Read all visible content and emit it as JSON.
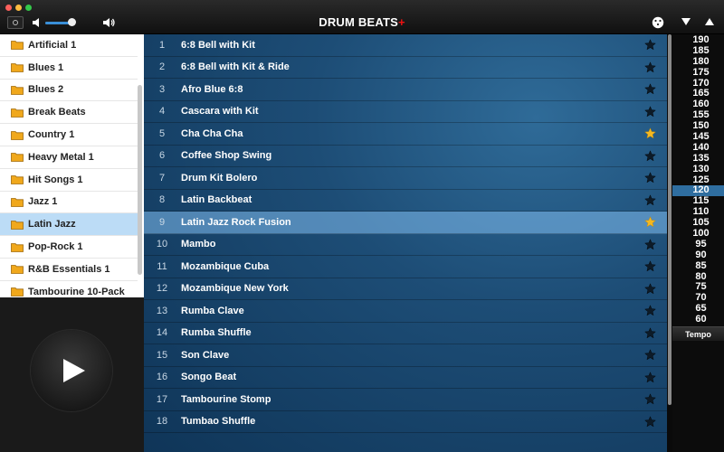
{
  "header": {
    "app_title": "DRUM BEATS",
    "app_title_mark": "+",
    "volume_level": 0.9
  },
  "categories": [
    {
      "label": "Artificial 1"
    },
    {
      "label": "Blues 1"
    },
    {
      "label": "Blues 2"
    },
    {
      "label": "Break Beats"
    },
    {
      "label": "Country 1"
    },
    {
      "label": "Heavy Metal 1"
    },
    {
      "label": "Hit Songs 1"
    },
    {
      "label": "Jazz 1"
    },
    {
      "label": "Latin Jazz",
      "selected": true
    },
    {
      "label": "Pop-Rock 1"
    },
    {
      "label": "R&B Essentials 1"
    },
    {
      "label": "Tambourine 10-Pack"
    }
  ],
  "beats": [
    {
      "num": "1",
      "name": "6:8 Bell with Kit",
      "favorite": false
    },
    {
      "num": "2",
      "name": "6:8 Bell with Kit & Ride",
      "favorite": false
    },
    {
      "num": "3",
      "name": "Afro Blue 6:8",
      "favorite": false
    },
    {
      "num": "4",
      "name": "Cascara with Kit",
      "favorite": false
    },
    {
      "num": "5",
      "name": "Cha Cha Cha",
      "favorite": true
    },
    {
      "num": "6",
      "name": "Coffee Shop Swing",
      "favorite": false
    },
    {
      "num": "7",
      "name": "Drum Kit Bolero",
      "favorite": false
    },
    {
      "num": "8",
      "name": "Latin Backbeat",
      "favorite": false
    },
    {
      "num": "9",
      "name": "Latin Jazz Rock Fusion",
      "favorite": true,
      "selected": true
    },
    {
      "num": "10",
      "name": "Mambo",
      "favorite": false
    },
    {
      "num": "11",
      "name": "Mozambique Cuba",
      "favorite": false
    },
    {
      "num": "12",
      "name": "Mozambique New York",
      "favorite": false
    },
    {
      "num": "13",
      "name": "Rumba Clave",
      "favorite": false
    },
    {
      "num": "14",
      "name": "Rumba Shuffle",
      "favorite": false
    },
    {
      "num": "15",
      "name": "Son Clave",
      "favorite": false
    },
    {
      "num": "16",
      "name": "Songo Beat",
      "favorite": false
    },
    {
      "num": "17",
      "name": "Tambourine Stomp",
      "favorite": false
    },
    {
      "num": "18",
      "name": "Tumbao Shuffle",
      "favorite": false
    }
  ],
  "tempo": {
    "values": [
      "190",
      "185",
      "180",
      "175",
      "170",
      "165",
      "160",
      "155",
      "150",
      "145",
      "140",
      "135",
      "130",
      "125",
      "120",
      "115",
      "110",
      "105",
      "100",
      "95",
      "90",
      "85",
      "80",
      "75",
      "70",
      "65",
      "60"
    ],
    "selected": "120",
    "label": "Tempo"
  },
  "colors": {
    "star_favorite": "#f5b820",
    "star_normal": "#0d1b28",
    "accent": "#2f6ea0",
    "brand_mark": "#e11111"
  },
  "icons": {
    "settings": "settings-icon",
    "volume_low": "speaker-low-icon",
    "volume_high": "speaker-high-icon",
    "random": "dice-icon",
    "next": "arrow-down-icon",
    "previous": "arrow-up-icon",
    "folder": "folder-icon",
    "star": "star-icon",
    "play": "play-icon"
  }
}
